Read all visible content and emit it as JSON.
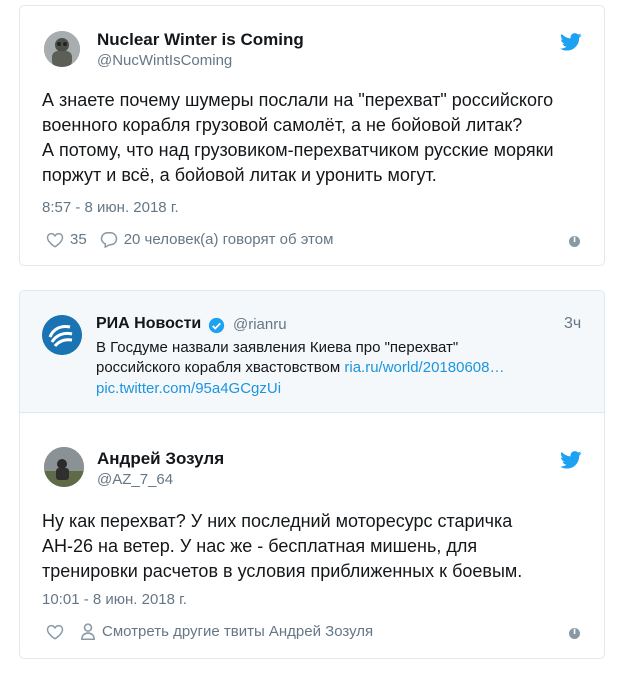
{
  "tweet1": {
    "name": "Nuclear Winter is Coming",
    "handle": "@NucWintIsComing",
    "lines": [
      "А знаете почему шумеры послали на \"перехват\" российского",
      "военного корабля грузовой самолёт, а не бойовой литак?",
      "А потому, что над грузовиком-перехватчиком русские моряки",
      "поржут и всё, а бойовой литак и уронить могут."
    ],
    "timestamp": "8:57 - 8 июн. 2018 г.",
    "likes": "35",
    "talking": "20 человек(а) говорят об этом",
    "icons": {
      "bird": "twitter-bird-icon",
      "heart": "heart-icon",
      "reply": "reply-icon",
      "info": "info-icon"
    }
  },
  "quoted": {
    "name": "РИА Новости",
    "handle": "@rianru",
    "time": "3ч",
    "line1": "В Госдуме назвали заявления Киева про \"перехват\"",
    "line2_text": "российского корабля хвастовством ",
    "line2_link": "ria.ru/world/20180608…",
    "line3_link": "pic.twitter.com/95a4GCgzUi"
  },
  "tweet2": {
    "name": "Андрей Зозуля",
    "handle": "@AZ_7_64",
    "lines": [
      "Ну как перехват? У них последний моторесурс старичка",
      "АН-26 на ветер. У нас же - бесплатная мишень, для",
      "тренировки расчетов в условия приближенных к боевым."
    ],
    "timestamp": "10:01 - 8 июн. 2018 г.",
    "more": "Смотреть другие твиты Андрей Зозуля"
  },
  "colors": {
    "accent": "#1da1f2",
    "link": "#1b95e0",
    "muted": "#657786",
    "border": "#e1e8ed"
  }
}
